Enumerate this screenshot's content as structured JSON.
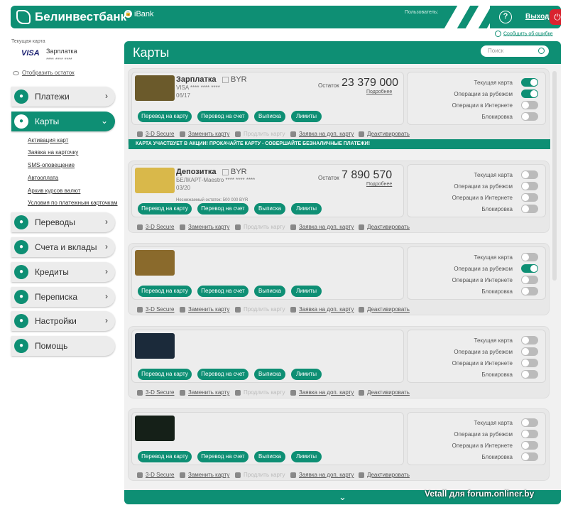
{
  "header": {
    "logo": "Белинвестбанк",
    "ibank": "iBank",
    "user_label": "Пользователь:",
    "logout": "Выход",
    "report": "Сообщить об ошибке"
  },
  "sidebar": {
    "current_card_label": "Текущая карта",
    "card_brand": "VISA",
    "card_name": "Зарплатка",
    "card_number": "**** **** ****",
    "show_balance": "Отобразить остаток",
    "nav": [
      {
        "label": "Платежи",
        "icon": "wallet-icon"
      },
      {
        "label": "Карты",
        "icon": "card-icon"
      },
      {
        "label": "Переводы",
        "icon": "transfer-icon"
      },
      {
        "label": "Счета и вклады",
        "icon": "account-icon"
      },
      {
        "label": "Кредиты",
        "icon": "credit-icon"
      },
      {
        "label": "Переписка",
        "icon": "mail-icon"
      },
      {
        "label": "Настройки",
        "icon": "gear-icon"
      },
      {
        "label": "Помощь",
        "icon": "question-icon"
      }
    ],
    "submenu": [
      "Активация карт",
      "Заявка на карточку",
      "SMS-оповещение",
      "Автооплата",
      "Архив курсов валют",
      "Условия по платежным карточкам"
    ]
  },
  "main": {
    "title": "Карты",
    "search_placeholder": "Поиск",
    "promo": "КАРТА УЧАСТВУЕТ В АКЦИИ! ПРОКАЧАЙТЕ КАРТУ - СОВЕРШАЙТЕ БЕЗНАЛИЧНЫЕ ПЛАТЕЖИ!",
    "buttons": [
      "Перевод на карту",
      "Перевод на счет",
      "Выписка",
      "Лимиты"
    ],
    "toggle_labels": [
      "Текущая карта",
      "Операции за рубежом",
      "Операции в Интернете",
      "Блокировка"
    ],
    "links": [
      "3-D Secure",
      "Заменить карту",
      "Продлить карту",
      "Заявка на доп. карту",
      "Деактивировать"
    ],
    "balance_label": "Остаток",
    "balance_more": "Подробнее",
    "cards": [
      {
        "name": "Зарплатка",
        "currency": "BYR",
        "type": "VISA **** **** ****",
        "expiry": "06/17",
        "balance": "23 379 000",
        "frozen": "",
        "toggles": [
          true,
          true,
          false,
          false
        ],
        "color": "#6b5a2b"
      },
      {
        "name": "Депозитка",
        "currency": "BYR",
        "type": "БЕЛКАРТ-Maestro **** **** ****",
        "expiry": "03/20",
        "balance": "7 890 570",
        "frozen": "Неснижаемый остаток: 500 000 BYR",
        "toggles": [
          false,
          false,
          false,
          false
        ],
        "color": "#d9b84a"
      },
      {
        "name": "",
        "currency": "",
        "type": "",
        "expiry": "",
        "balance": "",
        "frozen": "",
        "toggles": [
          false,
          true,
          false,
          false
        ],
        "color": "#8a6a2c"
      },
      {
        "name": "",
        "currency": "",
        "type": "",
        "expiry": "",
        "balance": "",
        "frozen": "",
        "toggles": [
          false,
          false,
          false,
          false
        ],
        "color": "#1b2a3a"
      },
      {
        "name": "",
        "currency": "",
        "type": "",
        "expiry": "",
        "balance": "",
        "frozen": "",
        "toggles": [
          false,
          false,
          false,
          false
        ],
        "color": "#152018"
      }
    ]
  },
  "watermark": "Vetall для forum.onliner.by"
}
